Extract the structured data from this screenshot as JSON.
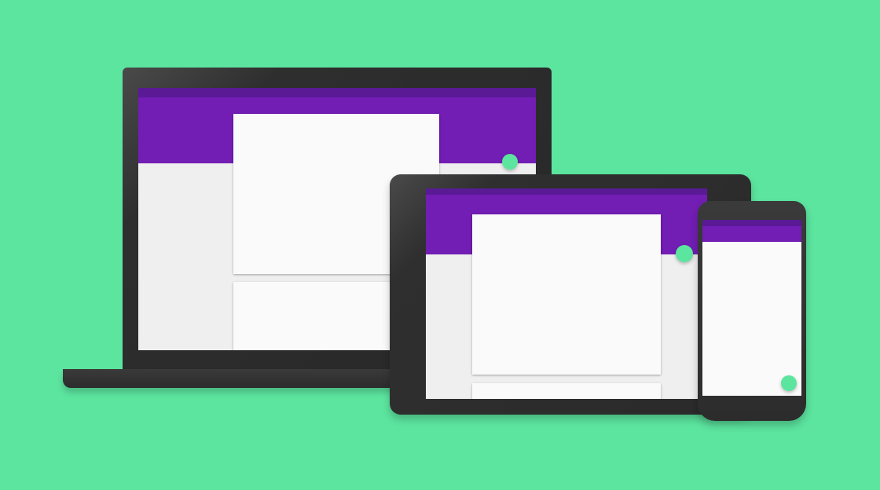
{
  "illustration": {
    "devices": [
      "laptop",
      "tablet",
      "phone"
    ]
  },
  "colors": {
    "background": "#5ce59f",
    "device_frame": "#2c2c2c",
    "status_bar": "#5a1a96",
    "app_bar": "#721db4",
    "screen_background": "#efefef",
    "card": "#fafafa",
    "fab": "#5ce59f"
  }
}
